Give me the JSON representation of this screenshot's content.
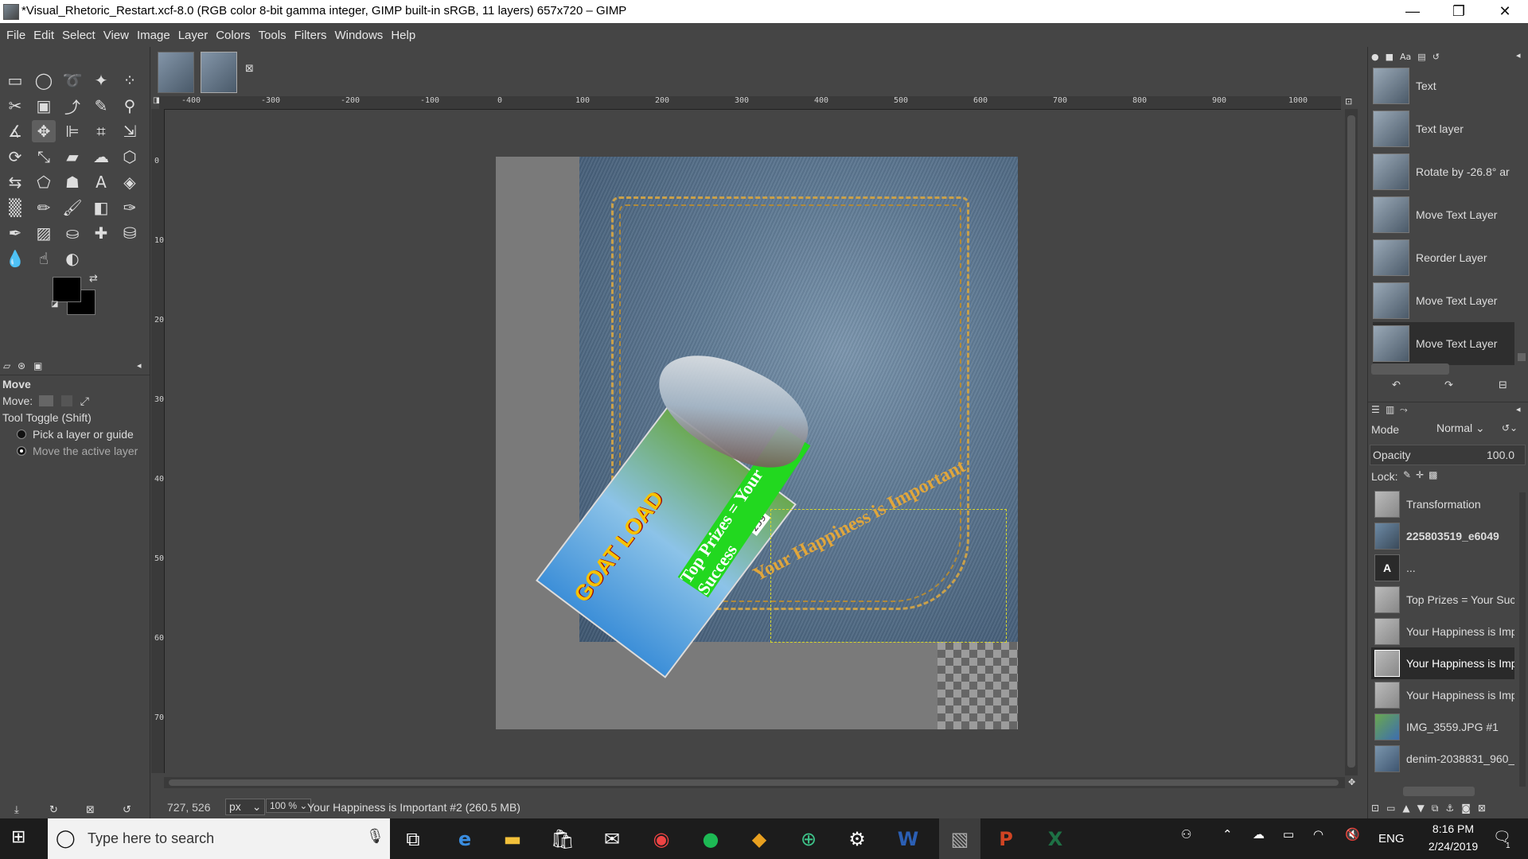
{
  "window": {
    "title": "*Visual_Rhetoric_Restart.xcf-8.0 (RGB color 8-bit gamma integer, GIMP built-in sRGB, 11 layers) 657x720 – GIMP",
    "minimize": "—",
    "maximize": "❐",
    "close": "✕"
  },
  "menubar": [
    "File",
    "Edit",
    "Select",
    "View",
    "Image",
    "Layer",
    "Colors",
    "Tools",
    "Filters",
    "Windows",
    "Help"
  ],
  "tool_options": {
    "tool_name": "Move",
    "move_label": "Move:",
    "toggle_label": "Tool Toggle  (Shift)",
    "option1": "Pick a layer or guide",
    "option2": "Move the active layer"
  },
  "ruler": {
    "h_ticks": [
      "-400",
      "-300",
      "-200",
      "-100",
      "0",
      "100",
      "200",
      "300",
      "400",
      "500",
      "600",
      "700",
      "800",
      "900",
      "1000"
    ],
    "v_ticks": [
      "0",
      "100",
      "200",
      "300",
      "400",
      "500",
      "600",
      "700"
    ]
  },
  "canvas": {
    "ticket_brand": "GOAT LOAD",
    "green_bar_text": "Top Prizes = Your Success",
    "curved_text": "Your Happiness is Important",
    "ticket_number": "259"
  },
  "status": {
    "coords": "727, 526",
    "unit": "px",
    "zoom": "100 %",
    "message": "Your Happiness is Important #2 (260.5 MB)"
  },
  "history": [
    {
      "label": "Text"
    },
    {
      "label": "Text layer"
    },
    {
      "label": "Rotate by -26.8° ar"
    },
    {
      "label": "Move Text Layer"
    },
    {
      "label": "Reorder Layer"
    },
    {
      "label": "Move Text Layer"
    },
    {
      "label": "Move Text Layer"
    }
  ],
  "layers_panel": {
    "mode_label": "Mode",
    "mode_value": "Normal",
    "opacity_label": "Opacity",
    "opacity_value": "100.0",
    "lock_label": "Lock:"
  },
  "layers": [
    {
      "name": "Transformation"
    },
    {
      "name": "225803519_e6049"
    },
    {
      "name": "..."
    },
    {
      "name": "Top Prizes = Your Suc"
    },
    {
      "name": "Your Happiness is Impo"
    },
    {
      "name": "Your Happiness is Impo"
    },
    {
      "name": "Your Happiness is Impo"
    },
    {
      "name": "IMG_3559.JPG #1"
    },
    {
      "name": "denim-2038831_960_"
    }
  ],
  "taskbar": {
    "search_placeholder": "Type here to search",
    "lang": "ENG",
    "time": "8:16 PM",
    "date": "2/24/2019",
    "notif_count": "1"
  },
  "colors": {
    "accent_green": "#22d81f",
    "panel_bg": "#454545",
    "taskbar_bg": "#1c1c1c"
  }
}
